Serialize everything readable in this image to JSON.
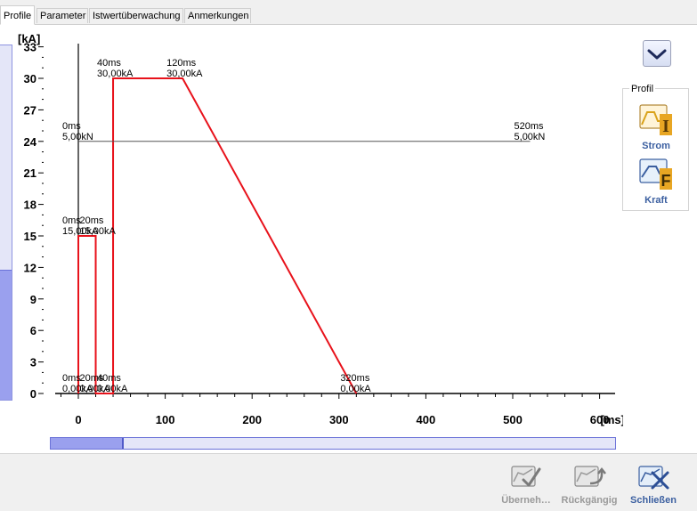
{
  "tabs": [
    {
      "label": "Profile",
      "active": true
    },
    {
      "label": "Parameter",
      "active": false
    },
    {
      "label": "Istwertüberwachung",
      "active": false
    },
    {
      "label": "Anmerkungen",
      "active": false
    }
  ],
  "chart_data": {
    "type": "line",
    "y_unit": "[kA]",
    "x_unit": "[ms]",
    "xlim": [
      -25,
      620
    ],
    "ylim": [
      0,
      34
    ],
    "x_ticks": [
      0,
      100,
      200,
      300,
      400,
      500,
      600
    ],
    "y_ticks": [
      0,
      3,
      6,
      9,
      12,
      15,
      18,
      21,
      24,
      27,
      30,
      33
    ],
    "grid": false,
    "series": [
      {
        "color": "#e8121b",
        "points": [
          [
            0,
            0
          ],
          [
            0,
            15
          ],
          [
            20,
            15
          ],
          [
            20,
            0
          ],
          [
            40,
            0
          ],
          [
            40,
            30
          ],
          [
            120,
            30
          ],
          [
            320,
            0
          ]
        ]
      },
      {
        "color": "#555555",
        "axis": "force",
        "points": [
          [
            0,
            24
          ],
          [
            520,
            24
          ]
        ]
      }
    ],
    "annotations": [
      {
        "x": 40,
        "y": 30,
        "lines": [
          "40ms",
          "30,00kA"
        ]
      },
      {
        "x": 120,
        "y": 30,
        "lines": [
          "120ms",
          "30,00kA"
        ]
      },
      {
        "x": 0,
        "y": 24,
        "lines": [
          "0ms",
          "5,00kN"
        ]
      },
      {
        "x": 520,
        "y": 24,
        "lines": [
          "520ms",
          "5,00kN"
        ]
      },
      {
        "x": 0,
        "y": 15,
        "lines": [
          "0ms",
          "15,00kA"
        ]
      },
      {
        "x": 20,
        "y": 15,
        "lines": [
          "20ms",
          "15,00kA"
        ]
      },
      {
        "x": 0,
        "y": 0,
        "lines": [
          "0ms",
          "0,00kA"
        ]
      },
      {
        "x": 20,
        "y": 0,
        "lines": [
          "20ms",
          "0,00kA"
        ]
      },
      {
        "x": 40,
        "y": 0,
        "lines": [
          "40ms",
          "0,00kA"
        ]
      },
      {
        "x": 320,
        "y": 0,
        "lines": [
          "320ms",
          "0,00kA"
        ]
      }
    ]
  },
  "profil": {
    "title": "Profil",
    "buttons": [
      {
        "label": "Strom",
        "icon": "current-profile-icon"
      },
      {
        "label": "Kraft",
        "icon": "force-profile-icon"
      }
    ]
  },
  "bottom": {
    "apply_label": "Überneh…",
    "undo_label": "Rückgängig",
    "close_label": "Schließen"
  },
  "colors": {
    "accent": "#3b5fa0",
    "profile_line": "#e8121b",
    "force_line": "#555555",
    "scroll_fill": "#9aa0ee"
  }
}
